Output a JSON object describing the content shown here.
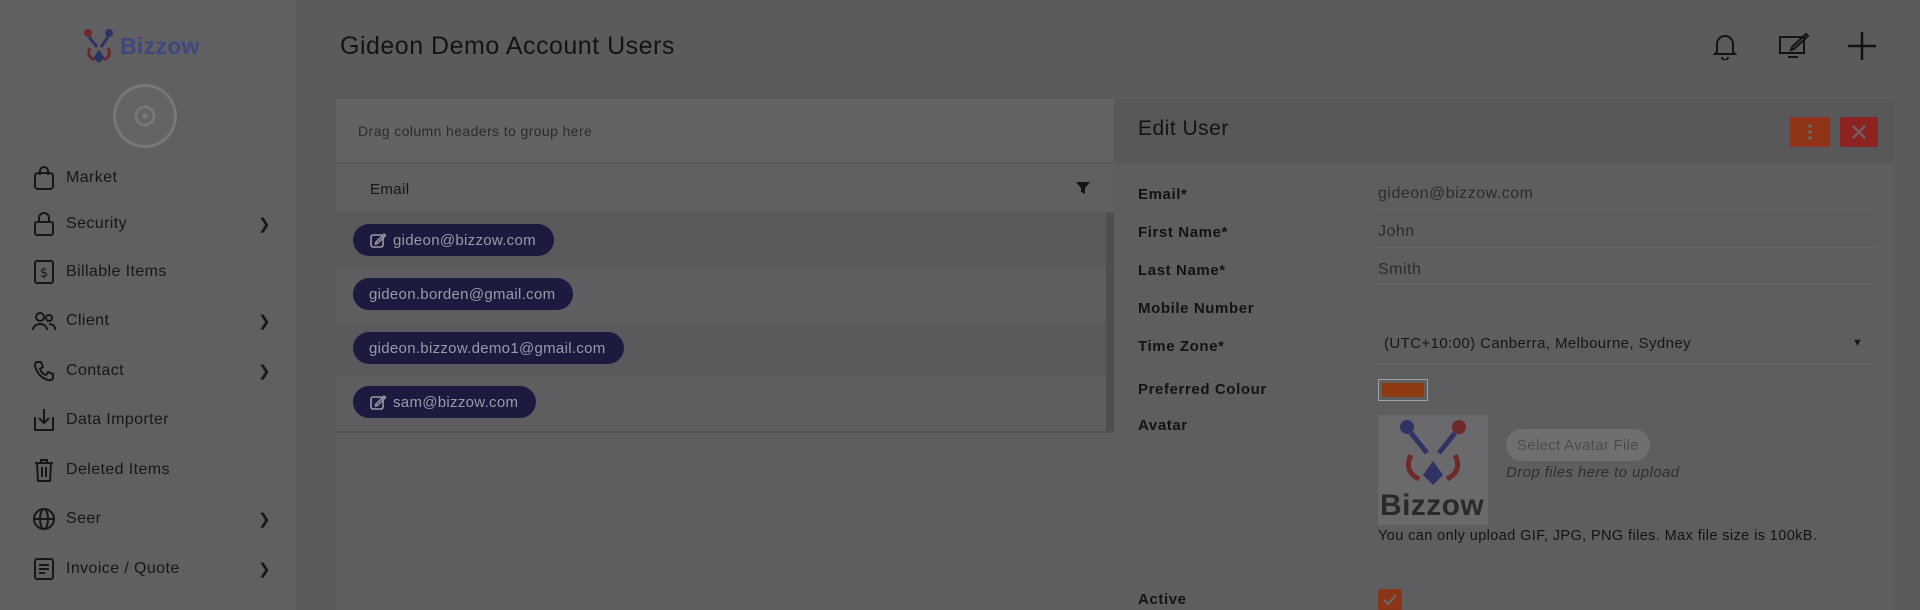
{
  "brand": {
    "name": "Bizzow"
  },
  "sidebar": {
    "items": [
      {
        "label": "Market",
        "icon": "bag-icon",
        "has_submenu": false
      },
      {
        "label": "Security",
        "icon": "lock-icon",
        "has_submenu": true
      },
      {
        "label": "Billable Items",
        "icon": "dollar-doc-icon",
        "has_submenu": false
      },
      {
        "label": "Client",
        "icon": "people-icon",
        "has_submenu": true
      },
      {
        "label": "Contact",
        "icon": "phone-icon",
        "has_submenu": true
      },
      {
        "label": "Data Importer",
        "icon": "import-icon",
        "has_submenu": false
      },
      {
        "label": "Deleted Items",
        "icon": "trash-icon",
        "has_submenu": false
      },
      {
        "label": "Seer",
        "icon": "globe-icon",
        "has_submenu": true
      },
      {
        "label": "Invoice / Quote",
        "icon": "invoice-icon",
        "has_submenu": true
      }
    ]
  },
  "header": {
    "title": "Gideon Demo Account Users",
    "icons": [
      "bell-icon",
      "edit-screen-icon",
      "plus-icon"
    ]
  },
  "grid": {
    "group_hint": "Drag column headers to group here",
    "column": "Email",
    "rows": [
      {
        "email": "gideon@bizzow.com",
        "editable": true
      },
      {
        "email": "gideon.borden@gmail.com",
        "editable": false
      },
      {
        "email": "gideon.bizzow.demo1@gmail.com",
        "editable": false
      },
      {
        "email": "sam@bizzow.com",
        "editable": true
      }
    ]
  },
  "edit_user": {
    "title": "Edit User",
    "fields": {
      "email_label": "Email*",
      "email_value": "gideon@bizzow.com",
      "first_name_label": "First Name*",
      "first_name_value": "John",
      "last_name_label": "Last Name*",
      "last_name_value": "Smith",
      "mobile_label": "Mobile Number",
      "mobile_value": "",
      "timezone_label": "Time Zone*",
      "timezone_value": "(UTC+10:00) Canberra, Melbourne, Sydney",
      "colour_label": "Preferred Colour",
      "colour_value": "#8e3a10",
      "avatar_label": "Avatar",
      "avatar_logo_text": "Bizzow",
      "select_file_label": "Select Avatar File",
      "drop_hint": "Drop files here to upload",
      "upload_note": "You can only upload GIF, JPG, PNG files. Max file size is 100kB.",
      "active_label": "Active",
      "active_checked": true
    }
  },
  "colors": {
    "accent_orange": "#8f3419",
    "close_red": "#8d2323",
    "chip_navy": "#1c1b3f"
  }
}
